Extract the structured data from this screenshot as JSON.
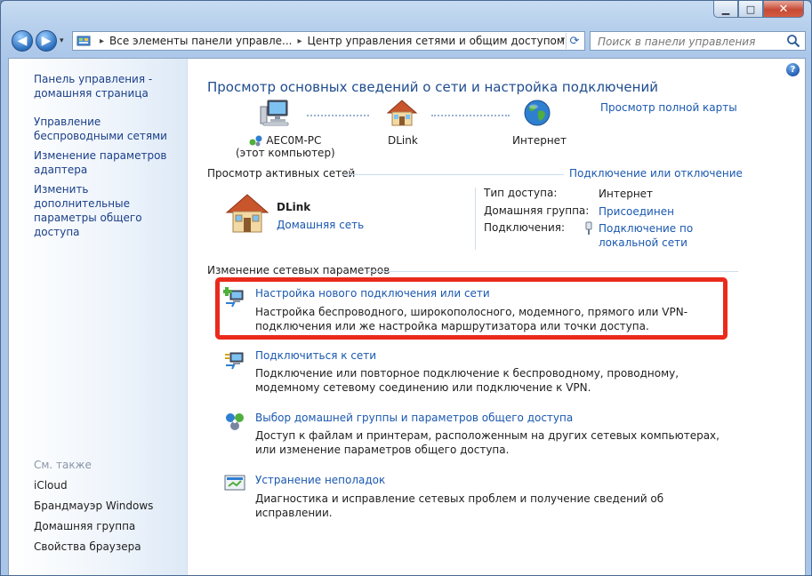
{
  "window": {
    "caption_buttons": {
      "minimize": "▁",
      "maximize": "□",
      "close": "✕"
    }
  },
  "toolbar": {
    "back": "◀",
    "forward": "▶",
    "history_arrow": "▾",
    "breadcrumb": [
      "Все элементы панели управле...",
      "Центр управления сетями и общим доступом"
    ],
    "breadcrumb_separator": "▸",
    "dropdown": "▾",
    "refresh": "⟳",
    "search_placeholder": "Поиск в панели управления"
  },
  "sidebar": {
    "links": [
      "Панель управления - домашняя страница",
      "Управление беспроводными сетями",
      "Изменение параметров адаптера",
      "Изменить дополнительные параметры общего доступа"
    ],
    "see_also_title": "См. также",
    "see_also": [
      "iCloud",
      "Брандмауэр Windows",
      "Домашняя группа",
      "Свойства браузера"
    ]
  },
  "help": "?",
  "main": {
    "title": "Просмотр основных сведений о сети и настройка подключений",
    "full_map_link": "Просмотр полной карты",
    "map": {
      "computer_name": "AEC0M-PC",
      "computer_sub": "(этот компьютер)",
      "router": "DLink",
      "internet": "Интернет"
    },
    "active_networks": {
      "heading": "Просмотр активных сетей",
      "connect_link": "Подключение или отключение",
      "network_name": "DLink",
      "network_type": "Домашняя сеть",
      "props": [
        {
          "label": "Тип доступа:",
          "value": "Интернет"
        },
        {
          "label": "Домашняя группа:",
          "value": "Присоединен"
        },
        {
          "label": "Подключения:",
          "value": "Подключение по локальной сети"
        }
      ]
    },
    "change_settings": {
      "heading": "Изменение сетевых параметров",
      "tasks": [
        {
          "title": "Настройка нового подключения или сети",
          "desc": "Настройка беспроводного, широкополосного, модемного, прямого или VPN-подключения или же настройка маршрутизатора или точки доступа."
        },
        {
          "title": "Подключиться к сети",
          "desc": "Подключение или повторное подключение к беспроводному, проводному, модемному сетевому соединению или подключение к VPN."
        },
        {
          "title": "Выбор домашней группы и параметров общего доступа",
          "desc": "Доступ к файлам и принтерам, расположенным на других сетевых компьютерах, или изменение параметров общего доступа."
        },
        {
          "title": "Устранение неполадок",
          "desc": "Диагностика и исправление сетевых проблем и получение сведений об исправлении."
        }
      ]
    }
  },
  "colors": {
    "link": "#1a58b0",
    "title": "#1e4c8e",
    "highlight": "#ea2a1c"
  }
}
